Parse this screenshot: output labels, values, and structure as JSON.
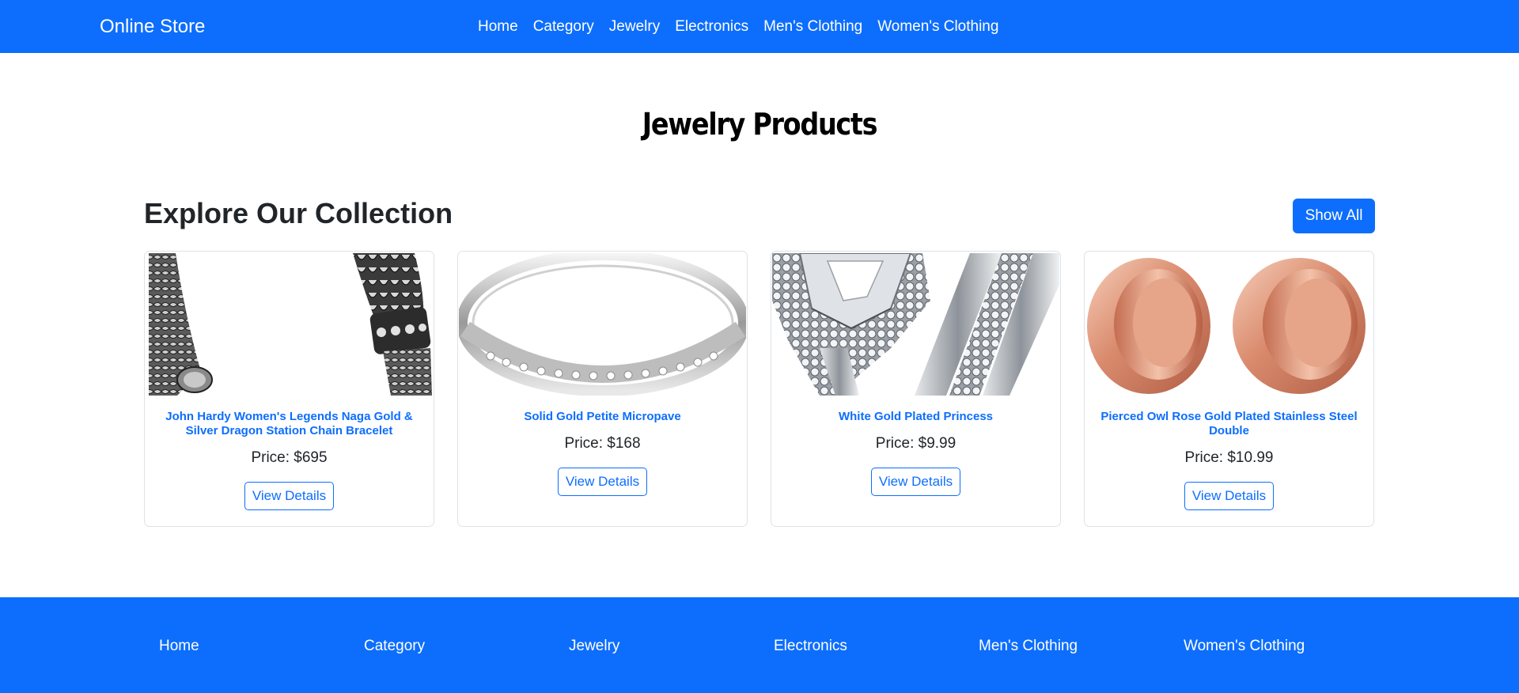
{
  "navbar": {
    "brand": "Online Store",
    "links": [
      "Home",
      "Category",
      "Jewelry",
      "Electronics",
      "Men's Clothing",
      "Women's Clothing"
    ],
    "background": "#0d6efd"
  },
  "page": {
    "title": "Jewelry Products",
    "section_title": "Explore Our Collection",
    "show_all_label": "Show All"
  },
  "products": [
    {
      "title": "John Hardy Women's Legends Naga Gold & Silver Dragon Station Chain Bracelet",
      "price": "Price: $695",
      "button": "View Details",
      "image": "chain-bracelet"
    },
    {
      "title": "Solid Gold Petite Micropave",
      "price": "Price: $168",
      "button": "View Details",
      "image": "silver-ring"
    },
    {
      "title": "White Gold Plated Princess",
      "price": "Price: $9.99",
      "button": "View Details",
      "image": "diamond-ring"
    },
    {
      "title": "Pierced Owl Rose Gold Plated Stainless Steel Double",
      "price": "Price: $10.99",
      "button": "View Details",
      "image": "rose-gold-plugs"
    }
  ],
  "footer": {
    "links": [
      "Home",
      "Category",
      "Jewelry",
      "Electronics",
      "Men's Clothing",
      "Women's Clothing"
    ]
  },
  "colors": {
    "primary": "#0d6efd",
    "text": "#212529"
  }
}
